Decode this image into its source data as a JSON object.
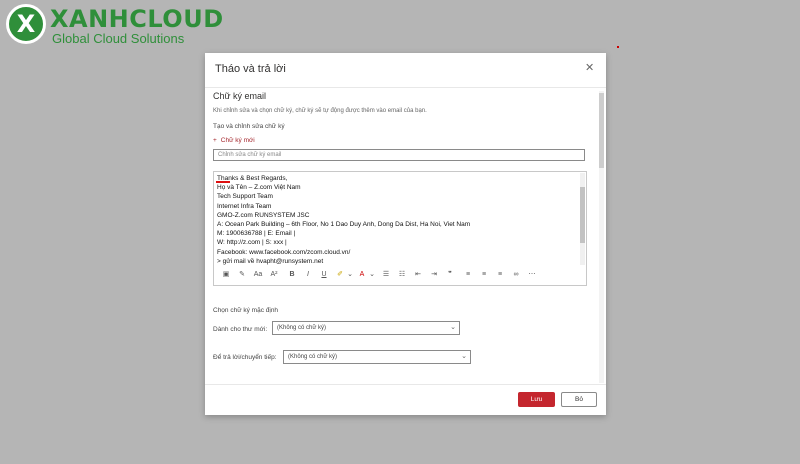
{
  "watermark": {
    "badge_letter": "X",
    "brand_name": "XANHCLOUD",
    "tagline": "Global Cloud Solutions"
  },
  "dialog": {
    "title": "Tháo và trả lời",
    "close_glyph": "✕",
    "section_title": "Chữ ký email",
    "description": "Khi chỉnh sửa và chọn chữ ký, chữ ký sẽ tự động được thêm vào email của bạn.",
    "create_label": "Tạo và chỉnh sửa chữ ký",
    "new_signature_plus": "+",
    "new_signature_label": "Chữ ký mới",
    "name_placeholder": "Chỉnh sửa chữ ký email",
    "signature_lines": [
      "Thanks & Best Regards,",
      "Họ và Tên – Z.com Việt Nam",
      "Tech Support Team",
      "Internet Infra Team",
      "GMO-Z.com RUNSYSTEM JSC",
      "A: Ocean Park Building – 6th Floor, No 1 Dao Duy Anh, Dong Da Dist, Ha Noi, Viet Nam",
      "M: 1900636788                       | E: Email |",
      "W: http://z.com                 | S: xxx |",
      "Facebook: www.facebook.com/zcom.cloud.vn/",
      "> gửi mail về hvapht@runsystem.net"
    ],
    "toolbar_icons": [
      "image-icon",
      "format-painter-icon",
      "font-size-icon",
      "superscript-icon",
      "bold-icon",
      "italic-icon",
      "underline-icon",
      "highlight-icon",
      "highlight-dropdown-icon",
      "font-color-icon",
      "font-color-dropdown-icon",
      "bullet-list-icon",
      "numbered-list-icon",
      "decrease-indent-icon",
      "increase-indent-icon",
      "quote-icon",
      "align-left-icon",
      "align-center-icon",
      "align-right-icon",
      "link-icon",
      "more-icon"
    ],
    "default_title": "Chọn chữ ký mặc định",
    "for_new_label": "Dành cho thư mới:",
    "for_new_value": "(Không có chữ ký)",
    "for_reply_label": "Để trả lời/chuyển tiếp:",
    "for_reply_value": "(Không có chữ ký)",
    "save_label": "Lưu",
    "cancel_label": "Bỏ"
  },
  "colors": {
    "brand_green": "#2f8f3a",
    "accent_red": "#c4262e",
    "backdrop": "#b5b5b5"
  }
}
